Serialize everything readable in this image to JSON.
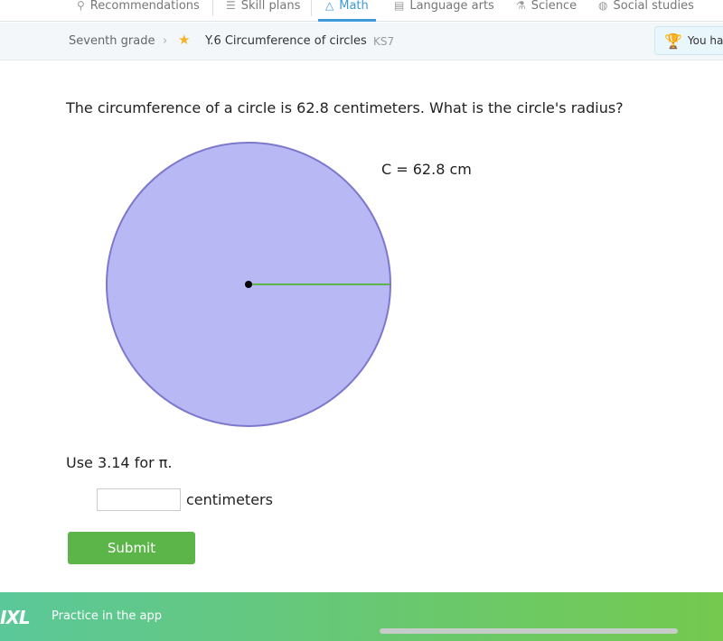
{
  "nav": {
    "items": [
      {
        "label": "Recommendations",
        "icon": "recommendations-icon",
        "glyph": "⚲"
      },
      {
        "label": "Skill plans",
        "icon": "checklist-icon",
        "glyph": "☰"
      },
      {
        "label": "Math",
        "icon": "pyramid-icon",
        "glyph": "△",
        "active": true
      },
      {
        "label": "Language arts",
        "icon": "book-icon",
        "glyph": "▤"
      },
      {
        "label": "Science",
        "icon": "flask-icon",
        "glyph": "⚗"
      },
      {
        "label": "Social studies",
        "icon": "globe-icon",
        "glyph": "◍"
      }
    ]
  },
  "breadcrumb": {
    "grade": "Seventh grade",
    "skill": "Y.6 Circumference of circles",
    "code": "KS7"
  },
  "award": {
    "text": "You ha"
  },
  "question": {
    "text": "The circumference of a circle is 62.8 centimeters. What is the circle's radius?",
    "circle_label": "C = 62.8 cm",
    "hint": "Use 3.14 for π.",
    "unit": "centimeters",
    "answer_value": "",
    "submit": "Submit"
  },
  "colors": {
    "circle_fill": "#b8b9f4",
    "circle_stroke": "#7d78cc",
    "radius": "#5cb548",
    "accent": "#3c9bd8",
    "submit": "#5bb548"
  },
  "footer": {
    "logo": "IXL",
    "text": "Practice in the app"
  }
}
